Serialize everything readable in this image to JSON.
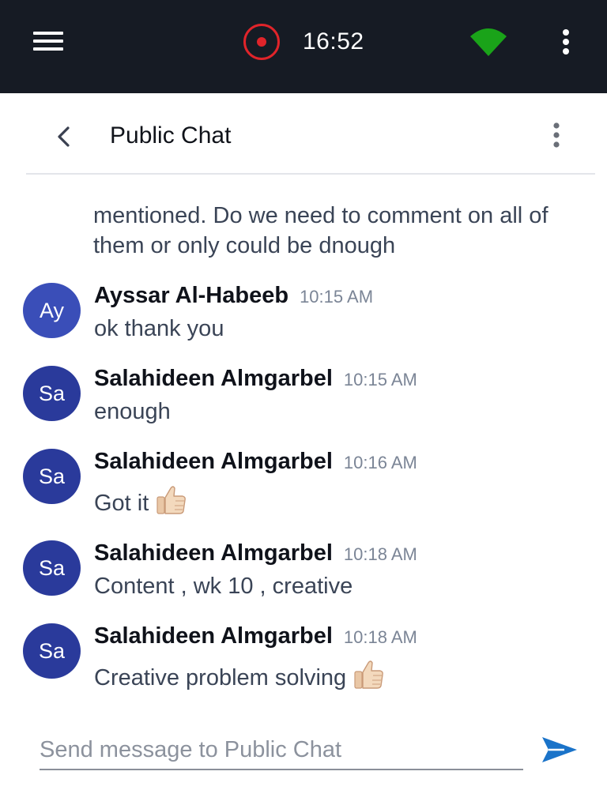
{
  "topbar": {
    "menu_icon": "hamburger-menu-icon",
    "record_icon": "record-icon",
    "record_color": "#e0242a",
    "timer": "16:52",
    "signal_icon": "wifi-signal-icon",
    "signal_color": "#1aa319",
    "overflow_icon": "more-vertical-icon"
  },
  "chat_header": {
    "back_icon": "chevron-left-icon",
    "title": "Public Chat",
    "overflow_icon": "more-vertical-icon"
  },
  "messages": {
    "continued_text": "mentioned. Do we need to comment on all of them or only could be dnough",
    "items": [
      {
        "initials": "Ay",
        "sender": "Ayssar Al-Habeeb",
        "time": "10:15 AM",
        "text": "ok thank you",
        "emoji": null
      },
      {
        "initials": "Sa",
        "sender": "Salahideen Almgarbel",
        "time": "10:15 AM",
        "text": "enough",
        "emoji": null
      },
      {
        "initials": "Sa",
        "sender": "Salahideen Almgarbel",
        "time": "10:16 AM",
        "text": "Got it",
        "emoji": "thumbs-up-icon"
      },
      {
        "initials": "Sa",
        "sender": "Salahideen Almgarbel",
        "time": "10:18 AM",
        "text": "Content , wk 10 , creative",
        "emoji": null
      },
      {
        "initials": "Sa",
        "sender": "Salahideen Almgarbel",
        "time": "10:18 AM",
        "text": "Creative problem solving",
        "emoji": "thumbs-up-icon"
      }
    ]
  },
  "composer": {
    "placeholder": "Send message to Public Chat",
    "value": "",
    "send_icon": "send-icon",
    "send_color": "#1a73c9"
  },
  "colors": {
    "topbar_bg": "#161b24",
    "avatar_bg": "#2a3a9b",
    "avatar_alt_bg": "#3a4eb8"
  }
}
